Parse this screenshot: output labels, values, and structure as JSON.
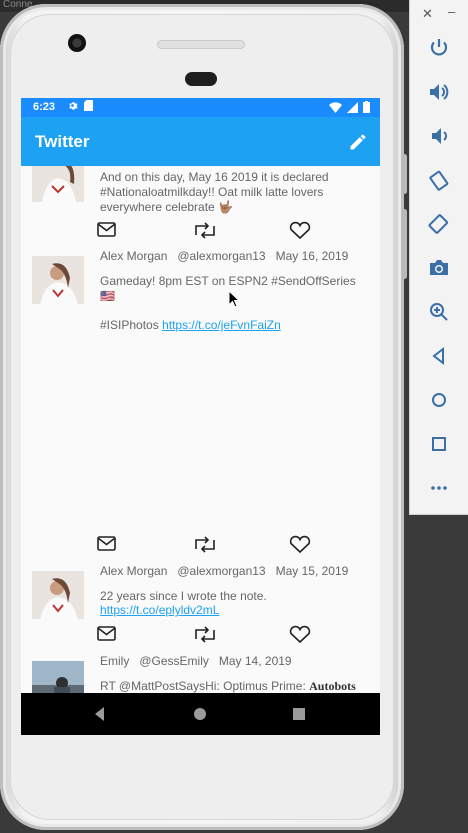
{
  "window": {
    "title": "Conne"
  },
  "status_bar": {
    "time": "6:23"
  },
  "app_bar": {
    "title": "Twitter"
  },
  "tweets": [
    {
      "author": "",
      "handle": "",
      "date": "",
      "text": "And on this day, May 16 2019 it is declared #Nationaloatmilkday!! Oat milk latte lovers everywhere celebrate 🤟🏽"
    },
    {
      "author": "Alex Morgan",
      "handle": "@alexmorgan13",
      "date": "May 16, 2019",
      "text": "Gameday! 8pm EST on ESPN2 #SendOffSeries 🇺🇸",
      "text2": "#ISIPhotos",
      "link": "https://t.co/jeFvnFaiZn"
    },
    {
      "author": "Alex Morgan",
      "handle": "@alexmorgan13",
      "date": "May 15, 2019",
      "text": "22 years since I wrote the note.",
      "link": "https://t.co/eplyldv2mL"
    },
    {
      "author": "Emily",
      "handle": "@GessEmily",
      "date": "May 14, 2019",
      "text": "RT @MattPostSaysHi: Optimus Prime: ",
      "text_bold": "Autobots"
    }
  ],
  "icons": {
    "status": [
      "gear-icon",
      "sd-card-icon",
      "wifi-icon",
      "signal-icon",
      "battery-icon"
    ],
    "actions": [
      "mail-icon",
      "retweet-icon",
      "heart-icon"
    ],
    "nav": [
      "back-icon",
      "home-icon",
      "recents-icon"
    ],
    "emulator": [
      "power-icon",
      "volume-up-icon",
      "volume-down-icon",
      "rotate-left-icon",
      "rotate-right-icon",
      "camera-icon",
      "zoom-icon",
      "back-icon",
      "home-icon",
      "overview-icon",
      "more-icon"
    ]
  },
  "colors": {
    "status_bar": "#1a8cff",
    "app_bar": "#1da1f2",
    "link": "#1da1f2"
  }
}
